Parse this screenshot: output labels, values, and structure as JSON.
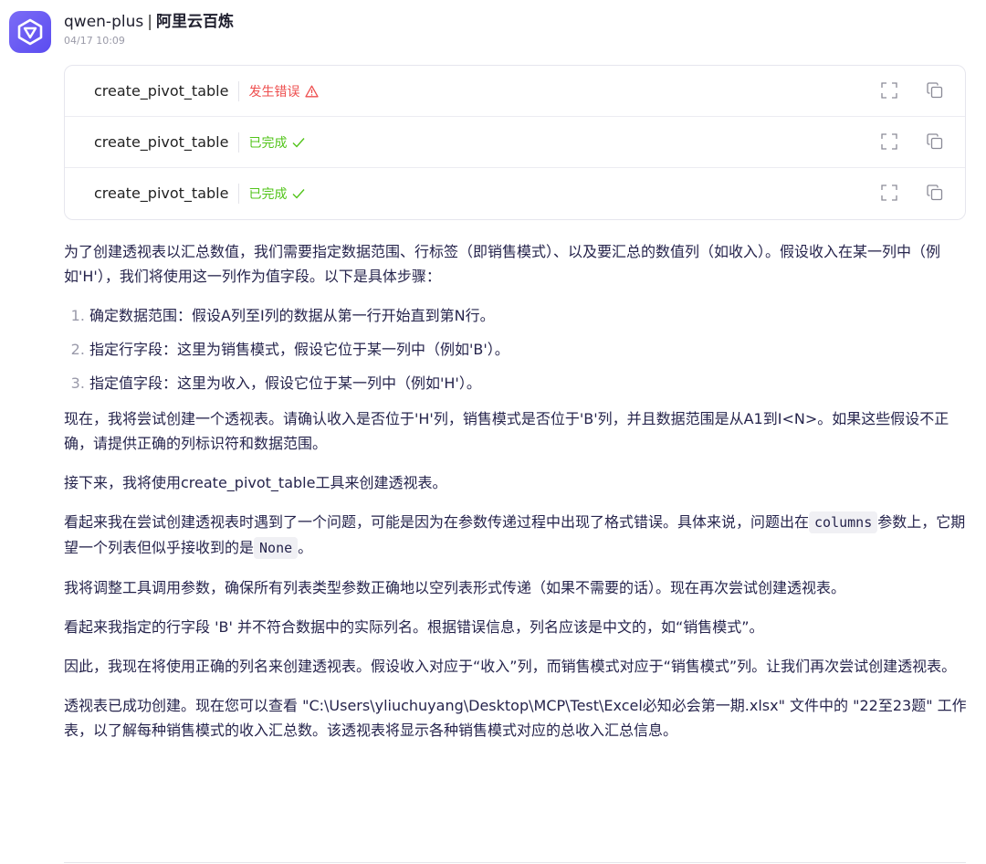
{
  "header": {
    "model": "qwen-plus",
    "separator": "|",
    "brand": "阿里云百炼",
    "timestamp": "04/17 10:09"
  },
  "tool_calls": [
    {
      "name": "create_pivot_table",
      "status": "发生错误",
      "status_type": "error"
    },
    {
      "name": "create_pivot_table",
      "status": "已完成",
      "status_type": "done"
    },
    {
      "name": "create_pivot_table",
      "status": "已完成",
      "status_type": "done"
    }
  ],
  "message": {
    "intro": "为了创建透视表以汇总数值，我们需要指定数据范围、行标签（即销售模式）、以及要汇总的数值列（如收入）。假设收入在某一列中（例如'H'），我们将使用这一列作为值字段。以下是具体步骤：",
    "steps": [
      "确定数据范围：假设A列至I列的数据从第一行开始直到第N行。",
      "指定行字段：这里为销售模式，假设它位于某一列中（例如'B'）。",
      "指定值字段：这里为收入，假设它位于某一列中（例如'H'）。"
    ],
    "p1": "现在，我将尝试创建一个透视表。请确认收入是否位于'H'列，销售模式是否位于'B'列，并且数据范围是从A1到I<N>。如果这些假设不正确，请提供正确的列标识符和数据范围。",
    "p2": "接下来，我将使用create_pivot_table工具来创建透视表。",
    "p3_a": "看起来我在尝试创建透视表时遇到了一个问题，可能是因为在参数传递过程中出现了格式错误。具体来说，问题出在",
    "p3_code1": "columns",
    "p3_b": "参数上，它期望一个列表但似乎接收到的是",
    "p3_code2": "None",
    "p3_c": "。",
    "p4": "我将调整工具调用参数，确保所有列表类型参数正确地以空列表形式传递（如果不需要的话）。现在再次尝试创建透视表。",
    "p5": "看起来我指定的行字段 'B' 并不符合数据中的实际列名。根据错误信息，列名应该是中文的，如“销售模式”。",
    "p6": "因此，我现在将使用正确的列名来创建透视表。假设收入对应于“收入”列，而销售模式对应于“销售模式”列。让我们再次尝试创建透视表。",
    "p7": "透视表已成功创建。现在您可以查看 \"C:\\Users\\yliuchuyang\\Desktop\\MCP\\Test\\Excel必知必会第一期.xlsx\" 文件中的 \"22至23题\" 工作表，以了解每种销售模式的收入汇总数。该透视表将显示各种销售模式对应的总收入汇总信息。"
  },
  "icons": {
    "avatar": "qwen-logo-icon",
    "error": "warning-triangle-icon",
    "done": "check-icon",
    "expand": "expand-icon",
    "copy": "copy-icon"
  },
  "colors": {
    "error": "#ee4f4f",
    "done": "#52c41a",
    "avatar": "#6c5cf5"
  }
}
